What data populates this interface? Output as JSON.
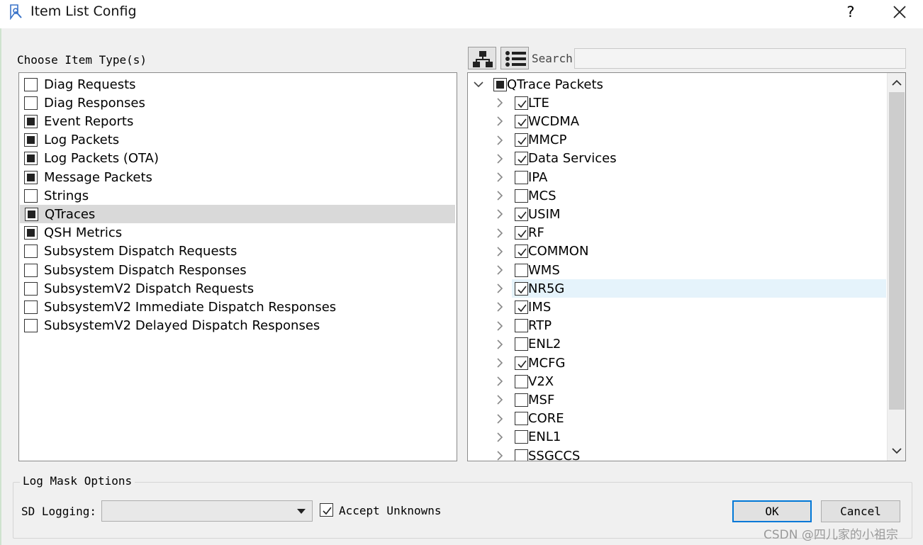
{
  "window": {
    "title": "Item List Config",
    "help_glyph": "?"
  },
  "left_panel": {
    "heading": "Choose Item Type(s)",
    "items": [
      {
        "label": "Diag Requests",
        "state": "unchecked"
      },
      {
        "label": "Diag Responses",
        "state": "unchecked"
      },
      {
        "label": "Event Reports",
        "state": "partial"
      },
      {
        "label": "Log Packets",
        "state": "partial"
      },
      {
        "label": "Log Packets (OTA)",
        "state": "partial"
      },
      {
        "label": "Message Packets",
        "state": "partial"
      },
      {
        "label": "Strings",
        "state": "unchecked"
      },
      {
        "label": "QTraces",
        "state": "partial",
        "selected": true
      },
      {
        "label": "QSH Metrics",
        "state": "partial"
      },
      {
        "label": "Subsystem Dispatch Requests",
        "state": "unchecked"
      },
      {
        "label": "Subsystem Dispatch Responses",
        "state": "unchecked"
      },
      {
        "label": "SubsystemV2 Dispatch Requests",
        "state": "unchecked"
      },
      {
        "label": "SubsystemV2 Immediate Dispatch Responses",
        "state": "unchecked"
      },
      {
        "label": "SubsystemV2 Delayed Dispatch Responses",
        "state": "unchecked"
      }
    ]
  },
  "right_panel": {
    "search_label": "Search",
    "search_value": "",
    "root": {
      "label": "QTrace Packets",
      "state": "partial"
    },
    "children": [
      {
        "label": "LTE",
        "state": "checked"
      },
      {
        "label": "WCDMA",
        "state": "checked"
      },
      {
        "label": "MMCP",
        "state": "checked"
      },
      {
        "label": "Data Services",
        "state": "checked"
      },
      {
        "label": "IPA",
        "state": "unchecked"
      },
      {
        "label": "MCS",
        "state": "unchecked"
      },
      {
        "label": "USIM",
        "state": "checked"
      },
      {
        "label": "RF",
        "state": "checked"
      },
      {
        "label": "COMMON",
        "state": "checked"
      },
      {
        "label": "WMS",
        "state": "unchecked"
      },
      {
        "label": "NR5G",
        "state": "checked",
        "highlighted": true
      },
      {
        "label": "IMS",
        "state": "checked"
      },
      {
        "label": "RTP",
        "state": "unchecked"
      },
      {
        "label": "ENL2",
        "state": "unchecked"
      },
      {
        "label": "MCFG",
        "state": "checked"
      },
      {
        "label": "V2X",
        "state": "unchecked"
      },
      {
        "label": "MSF",
        "state": "unchecked"
      },
      {
        "label": "CORE",
        "state": "unchecked"
      },
      {
        "label": "ENL1",
        "state": "unchecked"
      },
      {
        "label": "SSGCCS",
        "state": "unchecked"
      }
    ]
  },
  "log_mask": {
    "group_title": "Log Mask Options",
    "sd_logging_label": "SD Logging:",
    "sd_logging_value": "",
    "accept_unknowns_label": "Accept Unknowns",
    "accept_unknowns_checked": true
  },
  "buttons": {
    "ok": "OK",
    "cancel": "Cancel"
  },
  "watermark": "CSDN @四儿家的小祖宗",
  "colors": {
    "selection": "#d9d9d9",
    "hover_row": "#e5f3fb",
    "default_button_border": "#0078d7",
    "dialog_bg": "#f0f0f0"
  }
}
